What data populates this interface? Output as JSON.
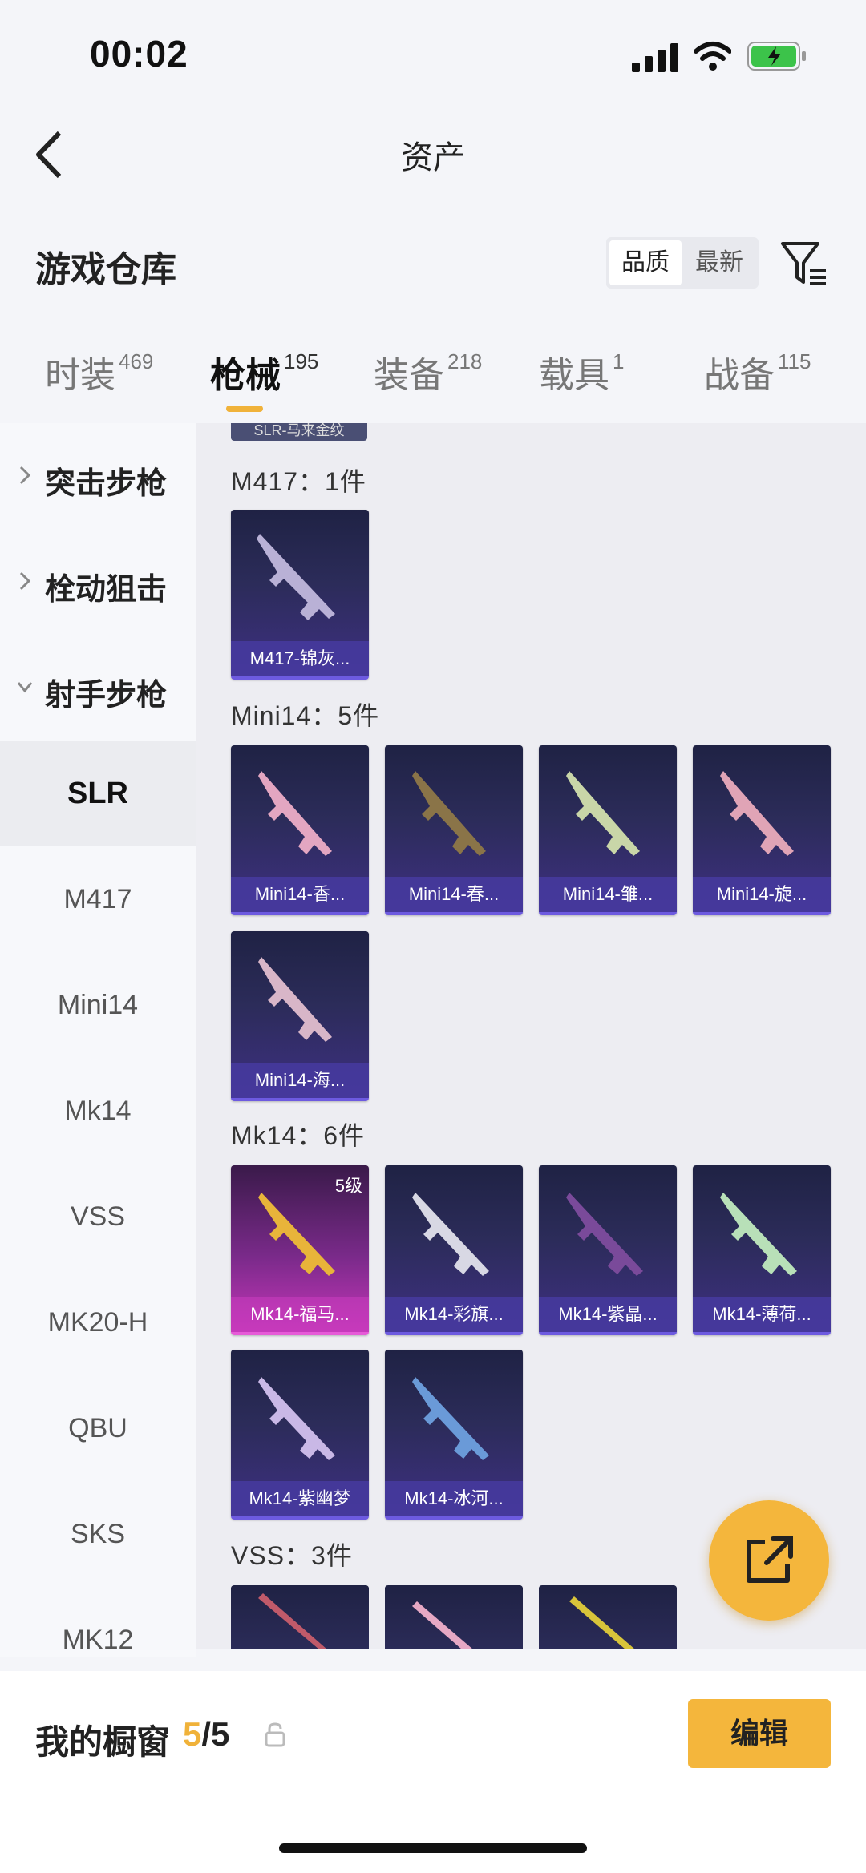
{
  "status_bar": {
    "time": "00:02"
  },
  "nav": {
    "title": "资产"
  },
  "section": {
    "title": "游戏仓库",
    "sort_options": [
      "品质",
      "最新"
    ]
  },
  "tabs": [
    {
      "label": "时装",
      "count": "469"
    },
    {
      "label": "枪械",
      "count": "195"
    },
    {
      "label": "装备",
      "count": "218"
    },
    {
      "label": "载具",
      "count": "1"
    },
    {
      "label": "战备",
      "count": "115"
    }
  ],
  "sidebar": {
    "categories": [
      "突击步枪",
      "栓动狙击",
      "射手步枪"
    ],
    "sub_items": [
      "SLR",
      "M417",
      "Mini14",
      "Mk14",
      "VSS",
      "MK20-H",
      "QBU",
      "SKS",
      "MK12"
    ]
  },
  "content": {
    "partial_top_label": "SLR-马来金纹",
    "groups": [
      {
        "label": "M417：1件",
        "items": [
          "M417-锦灰..."
        ]
      },
      {
        "label": "Mini14：5件",
        "items": [
          "Mini14-香...",
          "Mini14-春...",
          "Mini14-雏...",
          "Mini14-旋...",
          "Mini14-海..."
        ]
      },
      {
        "label": "Mk14：6件",
        "items": [
          "Mk14-福马...",
          "Mk14-彩旗...",
          "Mk14-紫晶...",
          "Mk14-薄荷...",
          "Mk14-紫幽梦",
          "Mk14-冰河..."
        ]
      },
      {
        "label": "VSS：3件"
      }
    ],
    "badge": "5级"
  },
  "bottom": {
    "showcase_label": "我的橱窗",
    "used": "5",
    "total": "/5",
    "edit_label": "编辑"
  },
  "colors": {
    "accent": "#f4b63c",
    "card_bg": "#2c2c5a",
    "card_gold": "#c536b8"
  },
  "icons": [
    "back-icon",
    "filter-icon",
    "share-icon",
    "lock-icon",
    "signal-icon",
    "wifi-icon",
    "battery-icon"
  ]
}
